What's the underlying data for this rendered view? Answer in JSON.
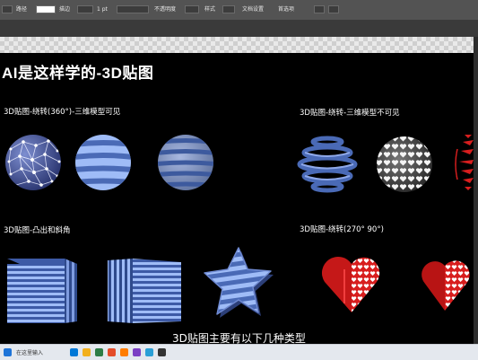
{
  "app": {
    "toolbar": {
      "items": [
        "路径",
        "描边",
        "1 pt",
        "不透明度",
        "样式",
        "文档设置",
        "首选项"
      ]
    }
  },
  "slide": {
    "title": "AI是这样学的-3D贴图",
    "sections": [
      {
        "label": "3D贴图-绕转(360°)-三维模型可见"
      },
      {
        "label": "3D贴图-绕转-三维模型不可见"
      },
      {
        "label": "3D贴图-凸出和斜角"
      },
      {
        "label": "3D贴图-绕转(270°   90°)"
      }
    ]
  },
  "subtitle": "3D贴图主要有以下几种类型",
  "taskbar": {
    "search_placeholder": "在这里输入"
  },
  "colors": {
    "stripe_light": "#96b4f2",
    "stripe_dark": "#4666b0",
    "heart_red": "#d81e1e",
    "artboard": "#000000"
  }
}
